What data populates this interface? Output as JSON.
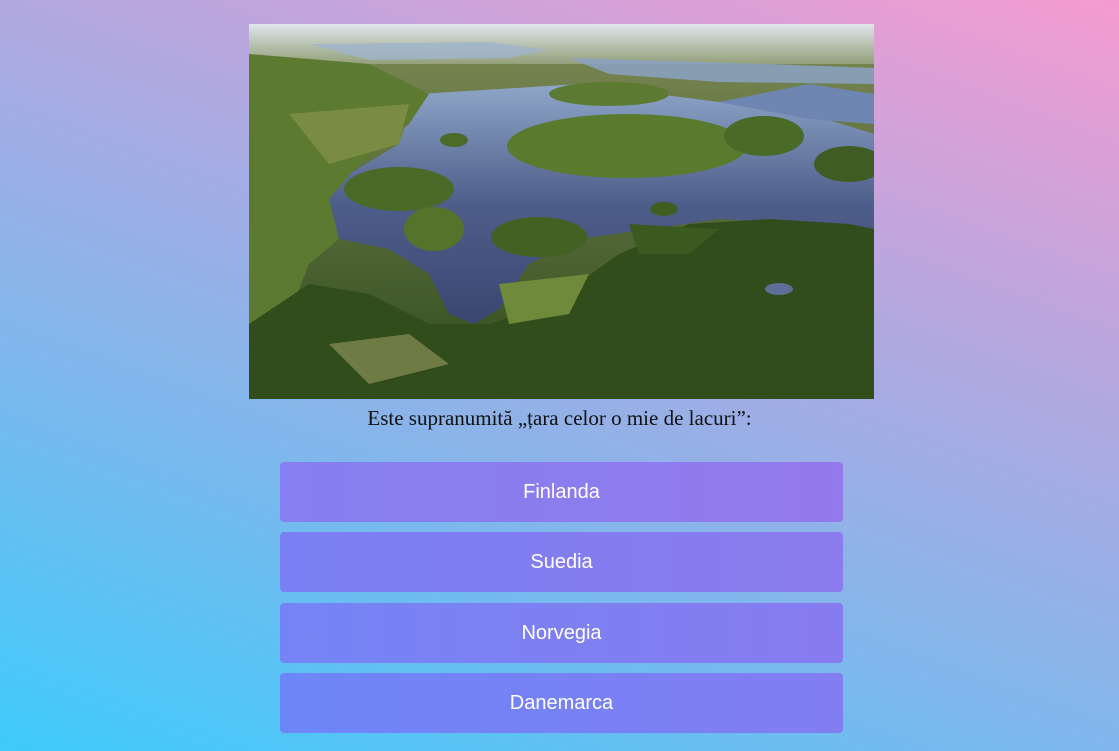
{
  "quiz": {
    "image_alt": "aerial-lakes-photo",
    "question": "Este supranumită „țara celor o mie de lacuri”:",
    "answers": [
      {
        "label": "Finlanda"
      },
      {
        "label": "Suedia"
      },
      {
        "label": "Norvegia"
      },
      {
        "label": "Danemarca"
      }
    ]
  },
  "colors": {
    "background_start": "#3ecbfb",
    "background_end": "#f49bd0",
    "button": "#8a7cf0",
    "button_text": "#ffffff"
  }
}
